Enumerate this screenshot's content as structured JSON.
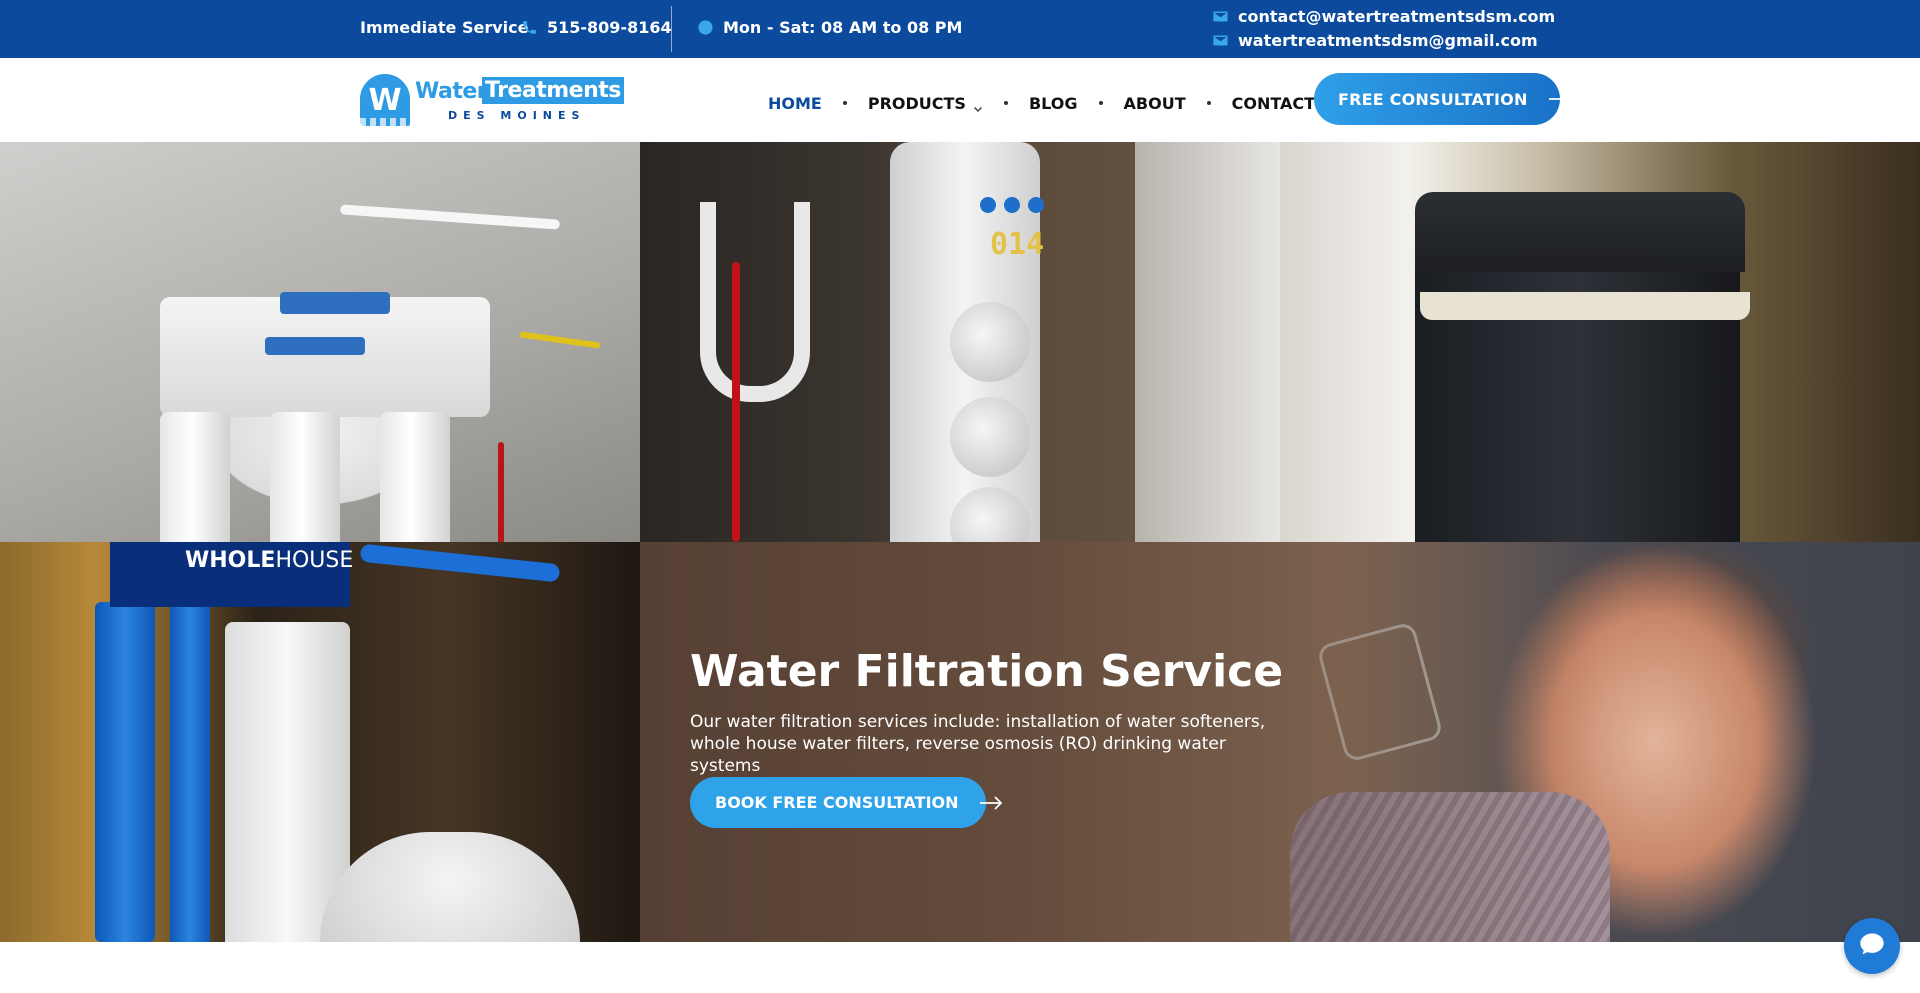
{
  "topbar": {
    "immediate_label": "Immediate Service",
    "phone": "515-809-8164",
    "hours": "Mon - Sat: 08 AM to 08 PM",
    "email_primary": "contact@watertreatmentsdsm.com",
    "email_secondary": "watertreatmentsdsm@gmail.com",
    "icons": {
      "phone": "phone-icon",
      "hours": "clock-icon",
      "email": "envelope-icon"
    }
  },
  "header": {
    "logo": {
      "badge": "W",
      "word1": "Water",
      "word2": "Treatments",
      "sub": "DES MOINES"
    },
    "nav": [
      {
        "label": "HOME",
        "active": true
      },
      {
        "label": "PRODUCTS",
        "has_dropdown": true
      },
      {
        "label": "BLOG"
      },
      {
        "label": "ABOUT"
      },
      {
        "label": "CONTACT"
      }
    ],
    "cta_label": "FREE CONSULTATION"
  },
  "hero": {
    "title": "Water Filtration Service",
    "description": "Our water filtration services include: installation of water softeners, whole house water filters, reverse osmosis (RO) drinking water systems",
    "button_label": "BOOK FREE CONSULTATION"
  },
  "photos": {
    "uc_display": "014",
    "wholehouse_label_bold": "WHOLE",
    "wholehouse_label": "HOUSE"
  },
  "colors": {
    "topbar_bg": "#0b4a9c",
    "accent_blue": "#2e9be4",
    "nav_active": "#0b4a9c",
    "button_blue": "#2fa3ea"
  },
  "chat_icon": "chat-bubble-icon"
}
